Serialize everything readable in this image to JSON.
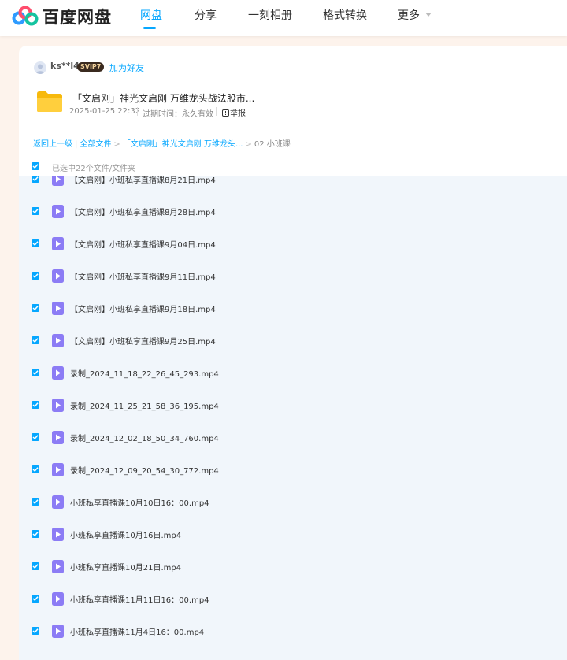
{
  "nav": {
    "logo_text": "百度网盘",
    "items": [
      "网盘",
      "分享",
      "一刻相册",
      "格式转换",
      "更多"
    ],
    "active_index": 0,
    "accent_color": "#06a7ff"
  },
  "share": {
    "username": "ks**l4",
    "vip_badge": "SVIP7",
    "add_friend": "加为好友",
    "title": "「文启刚」神光文启刚 万维龙头战法股市...",
    "date": "2025-01-25 22:32",
    "expiry": "过期时间：永久有效",
    "report": "举报",
    "folder_icon": "folder-icon"
  },
  "breadcrumb": {
    "back": "返回上一级",
    "all_files": "全部文件",
    "parent": "「文启刚」神光文启刚 万维龙头...",
    "current": "02 小班课"
  },
  "selection": {
    "text": "已选中22个文件/文件夹",
    "all_checked": true
  },
  "files": [
    {
      "name": "【文启刚】小班私享直播课8月21日.mp4",
      "checked": true
    },
    {
      "name": "【文启刚】小班私享直播课8月28日.mp4",
      "checked": true
    },
    {
      "name": "【文启刚】小班私享直播课9月04日.mp4",
      "checked": true
    },
    {
      "name": "【文启刚】小班私享直播课9月11日.mp4",
      "checked": true
    },
    {
      "name": "【文启刚】小班私享直播课9月18日.mp4",
      "checked": true
    },
    {
      "name": "【文启刚】小班私享直播课9月25日.mp4",
      "checked": true
    },
    {
      "name": "录制_2024_11_18_22_26_45_293.mp4",
      "checked": true
    },
    {
      "name": "录制_2024_11_25_21_58_36_195.mp4",
      "checked": true
    },
    {
      "name": "录制_2024_12_02_18_50_34_760.mp4",
      "checked": true
    },
    {
      "name": "录制_2024_12_09_20_54_30_772.mp4",
      "checked": true
    },
    {
      "name": "小班私享直播课10月10日16：00.mp4",
      "checked": true
    },
    {
      "name": "小班私享直播课10月16日.mp4",
      "checked": true
    },
    {
      "name": "小班私享直播课10月21日.mp4",
      "checked": true
    },
    {
      "name": "小班私享直播课11月11日16：00.mp4",
      "checked": true
    },
    {
      "name": "小班私享直播课11月4日16：00.mp4",
      "checked": true
    }
  ]
}
